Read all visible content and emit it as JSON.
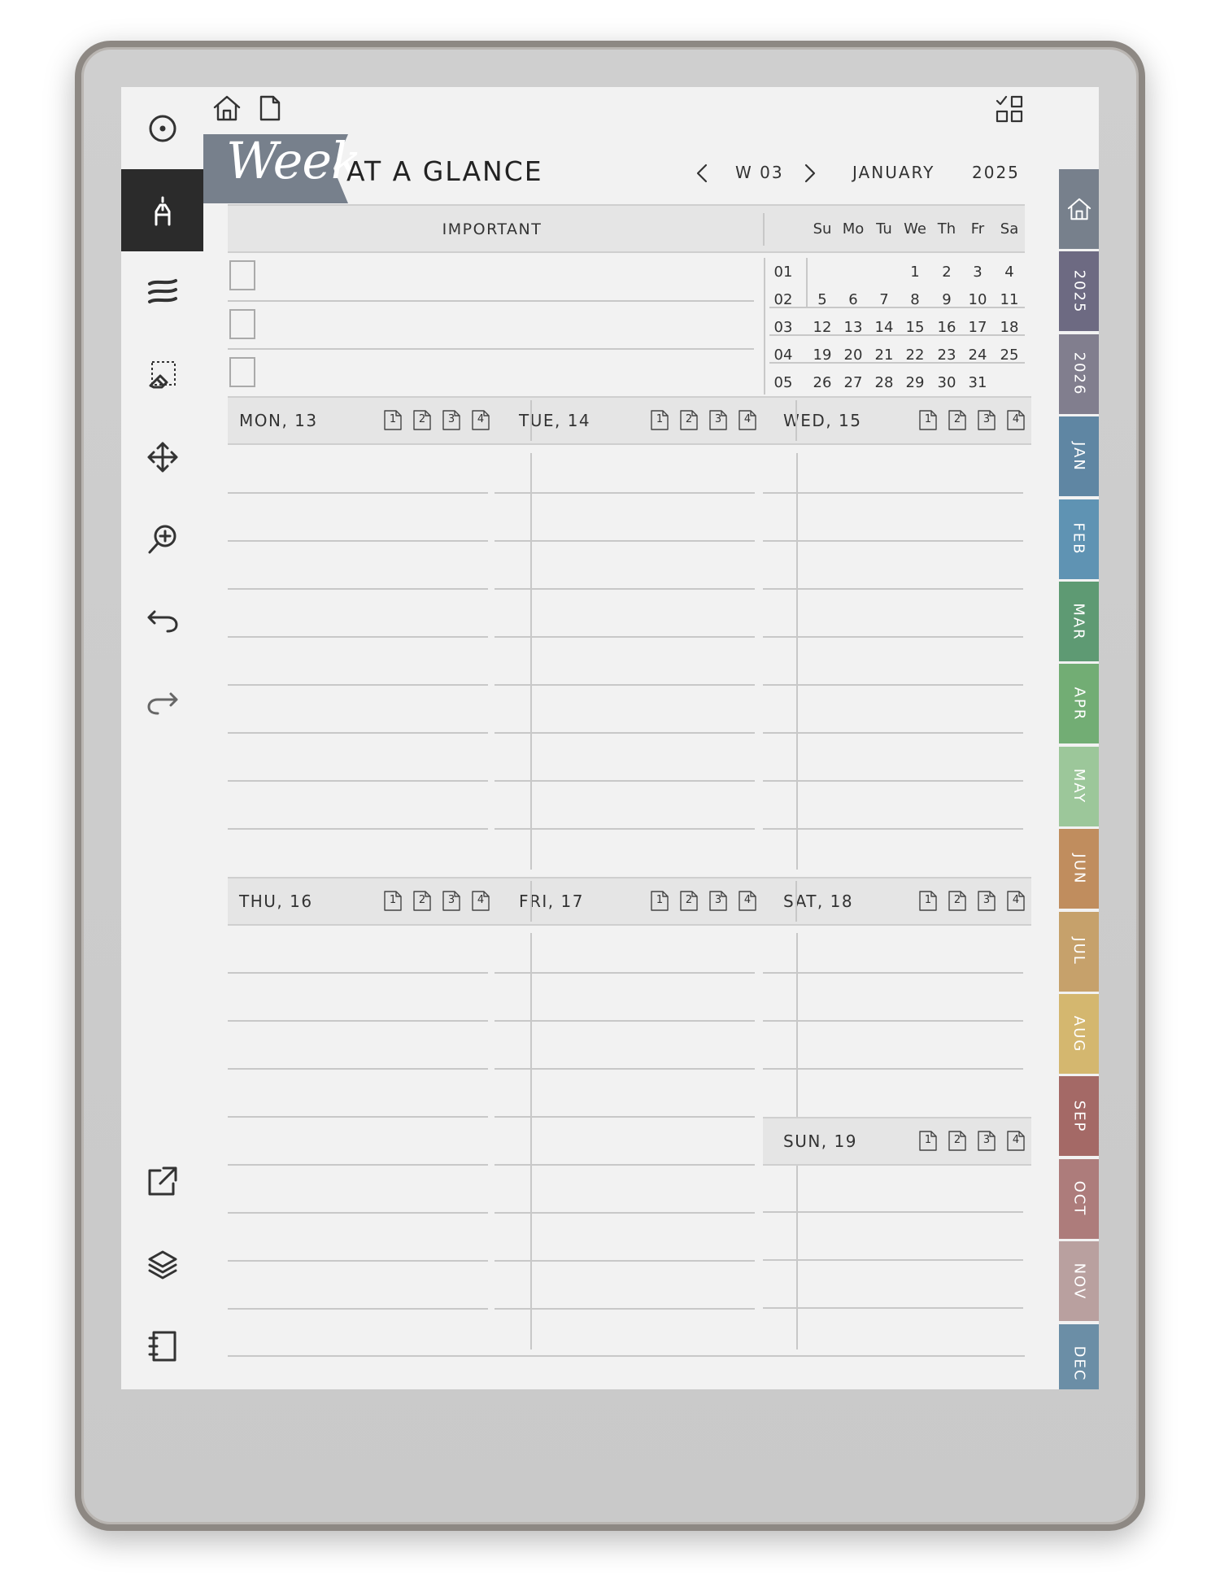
{
  "header": {
    "banner_word": "Week",
    "title": "AT A GLANCE",
    "week": "W 03",
    "month": "JANUARY",
    "year": "2025"
  },
  "important": {
    "label": "IMPORTANT",
    "items": [
      "",
      "",
      ""
    ]
  },
  "mini_calendar": {
    "weekdays": [
      "Su",
      "Mo",
      "Tu",
      "We",
      "Th",
      "Fr",
      "Sa"
    ],
    "weeks": [
      "01",
      "02",
      "03",
      "04",
      "05"
    ],
    "rows": [
      [
        "",
        "",
        "",
        "1",
        "2",
        "3",
        "4"
      ],
      [
        "5",
        "6",
        "7",
        "8",
        "9",
        "10",
        "11"
      ],
      [
        "12",
        "13",
        "14",
        "15",
        "16",
        "17",
        "18"
      ],
      [
        "19",
        "20",
        "21",
        "22",
        "23",
        "24",
        "25"
      ],
      [
        "26",
        "27",
        "28",
        "29",
        "30",
        "31",
        ""
      ]
    ]
  },
  "days": [
    {
      "label": "MON, 13"
    },
    {
      "label": "TUE, 14"
    },
    {
      "label": "WED, 15"
    },
    {
      "label": "THU, 16"
    },
    {
      "label": "FRI, 17"
    },
    {
      "label": "SAT, 18"
    },
    {
      "label": "SUN, 19"
    }
  ],
  "page_links": [
    "1",
    "2",
    "3",
    "4"
  ],
  "side_tabs": [
    {
      "label": "",
      "icon": "home-icon",
      "color": "#77808c"
    },
    {
      "label": "2025",
      "color": "#6d6a82"
    },
    {
      "label": "2026",
      "color": "#817e8e"
    },
    {
      "label": "JAN",
      "color": "#5f86a3"
    },
    {
      "label": "FEB",
      "color": "#5f93b3"
    },
    {
      "label": "MAR",
      "color": "#5e9a73"
    },
    {
      "label": "APR",
      "color": "#72ad74"
    },
    {
      "label": "MAY",
      "color": "#9cc79a"
    },
    {
      "label": "JUN",
      "color": "#c08d5e"
    },
    {
      "label": "JUL",
      "color": "#c6a16b"
    },
    {
      "label": "AUG",
      "color": "#d4b76f"
    },
    {
      "label": "SEP",
      "color": "#a46966"
    },
    {
      "label": "OCT",
      "color": "#ad7c7b"
    },
    {
      "label": "NOV",
      "color": "#b9a09f"
    },
    {
      "label": "DEC",
      "color": "#6b8ea6"
    }
  ],
  "toolbar": {
    "icons": [
      "menu-circle-icon",
      "pen-icon",
      "strokes-icon",
      "eraser-select-icon",
      "move-icon",
      "zoom-icon",
      "undo-icon",
      "redo-icon",
      "share-icon",
      "layers-icon",
      "notebook-icon"
    ]
  },
  "colors": {
    "banner": "#77808c",
    "screen": "#f2f2f2",
    "toolbar_active": "#2b2b2b"
  }
}
